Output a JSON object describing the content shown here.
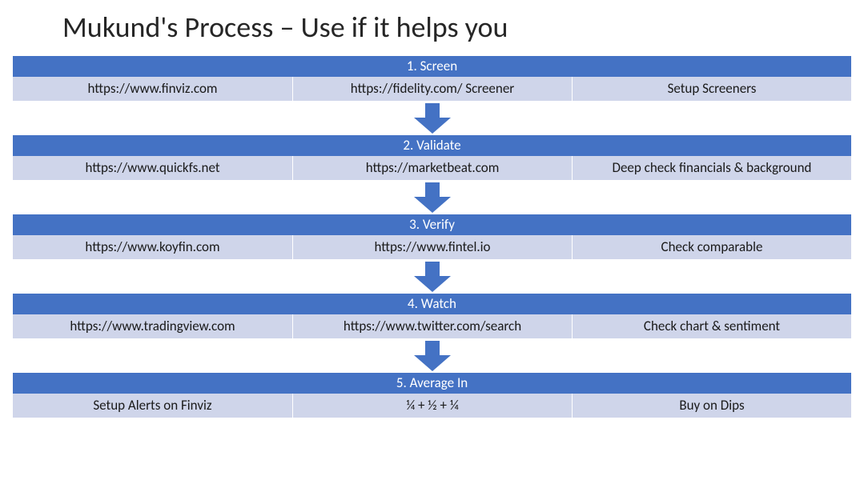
{
  "title": "Mukund's Process – Use if it helps you",
  "colors": {
    "header_bg": "#4472c4",
    "row_bg": "#cfd5ea",
    "arrow_fill": "#4472c4"
  },
  "steps": [
    {
      "label": "1. Screen",
      "cells": [
        "https://www.finviz.com",
        "https://fidelity.com/ Screener",
        "Setup Screeners"
      ]
    },
    {
      "label": "2. Validate",
      "cells": [
        "https://www.quickfs.net",
        "https://marketbeat.com",
        "Deep check financials & background"
      ]
    },
    {
      "label": "3. Verify",
      "cells": [
        "https://www.koyfin.com",
        "https://www.fintel.io",
        "Check comparable"
      ]
    },
    {
      "label": "4. Watch",
      "cells": [
        "https://www.tradingview.com",
        "https://www.twitter.com/search",
        "Check chart & sentiment"
      ]
    },
    {
      "label": "5. Average In",
      "cells": [
        "Setup Alerts on Finviz",
        "¼ + ½ + ¼",
        "Buy on Dips"
      ]
    }
  ]
}
